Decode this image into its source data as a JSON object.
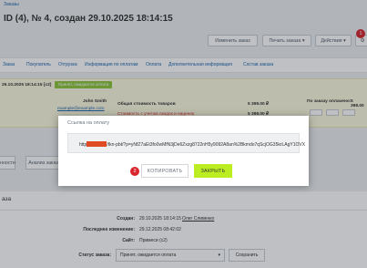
{
  "breadcrumb": "Заказы",
  "title": "ID (4), № 4, создан 29.10.2025 18:14:15",
  "toolbar": {
    "change_order": "Изменить заказ",
    "print_order": "Печать заказа",
    "actions": "Действия",
    "badge_1": "1"
  },
  "tabs": [
    "Заказ",
    "Покупатель",
    "Отгрузка",
    "Информация по оплатам",
    "Оплата",
    "Дополнительная информация",
    "Состав заказа"
  ],
  "info": {
    "date": "29.10.2025 18:14:15 [c2]",
    "status": "Принят, ожидается оплата",
    "customer_name": "John Smith",
    "customer_email": "example@example.com",
    "total_label": "Общая стоимость товаров",
    "total_value": "5 398.00 ₽",
    "total_with_label": "Стоимость с учетом скидок и наценок",
    "total_with_value": "5 398.00 ₽",
    "paid_label": "По заказу оплачено:",
    "paid_value": "5 398.00"
  },
  "dialog": {
    "title": "Ссылка на оплату",
    "url_prefix": "http",
    "url_suffix": "/tkn-pbt/?p=yNfZ7aEt3fo0wMfN3jDe6Zxzg8722nH5y9092A8an%2Bkmdo7qScjOG35krLAgY1OVX",
    "copy_label": "КОПИРОВАТЬ",
    "close_label": "ЗАКРЫТЬ",
    "badge_2": "2"
  },
  "lower_tabs": [
    "енности",
    "Анализ заказа"
  ],
  "section": {
    "title": "аза",
    "created_label": "Создан:",
    "created_value": "29.10.2025 18:14:15",
    "created_user": "Олег Сливенко",
    "modified_label": "Последнее изменение:",
    "modified_value": "29.12.2025 08:42:02",
    "site_label": "Сайт:",
    "site_value": "Примеси (c2)",
    "status_label": "Статус заказа:",
    "status_value": "Принят, ожидается оплата",
    "save_label": "Сохранить"
  },
  "colors": {
    "accent_green": "#bbed21",
    "badge_red": "#d7262d",
    "status_green": "#8fc73e",
    "link_blue": "#2067b0"
  }
}
